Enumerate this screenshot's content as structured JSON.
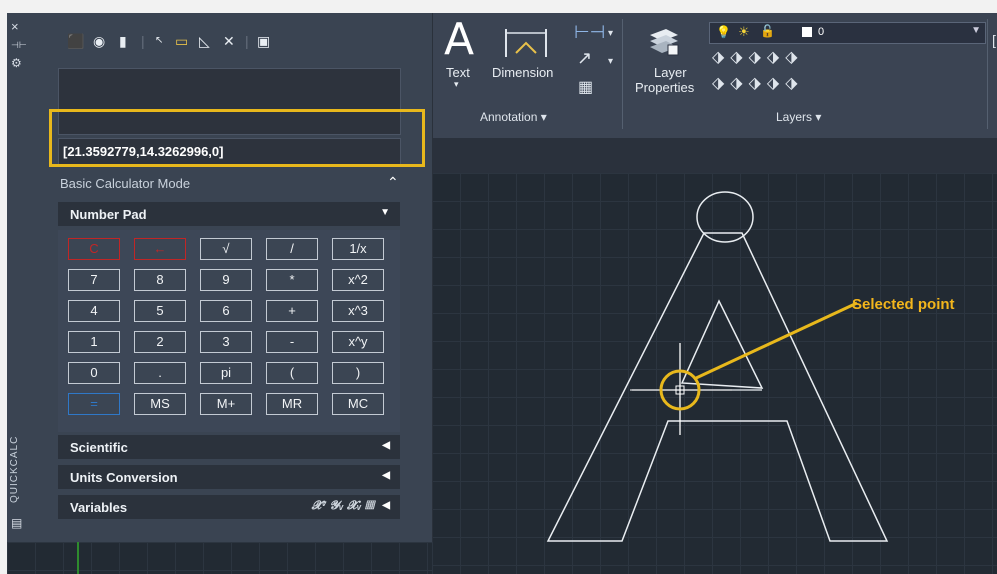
{
  "side": {
    "close_icon": "×",
    "title": "QUICKCALC"
  },
  "palette": {
    "input_value": "[21.3592779,14.3262996,0]",
    "mode_label": "Basic Calculator Mode",
    "mode_caret": "⌃",
    "number_pad_label": "Number Pad",
    "keys": [
      [
        "C",
        "←",
        "√",
        "/",
        "1/x"
      ],
      [
        "7",
        "8",
        "9",
        "*",
        "x^2"
      ],
      [
        "4",
        "5",
        "6",
        "+",
        "x^3"
      ],
      [
        "1",
        "2",
        "3",
        "-",
        "x^y"
      ],
      [
        "0",
        ".",
        "pi",
        "(",
        ")"
      ],
      [
        "=",
        "MS",
        "M+",
        "MR",
        "MC"
      ]
    ],
    "sections": [
      "Scientific",
      "Units Conversion",
      "Variables"
    ],
    "variables_icons": "𝓧ᵛ 𝓨ᵥ 𝓧ᵥ ▦"
  },
  "ribbon": {
    "text_tool": "Text",
    "text_icon": "A",
    "dimension_tool": "Dimension",
    "layer_properties_line1": "Layer",
    "layer_properties_line2": "Properties",
    "annotation_group": "Annotation ▾",
    "layers_group": "Layers ▾",
    "layer_value": "0"
  },
  "annotation": {
    "callout": "Selected point",
    "highlight_color": "#e8b81c",
    "callout_color": "#f2b51c"
  }
}
